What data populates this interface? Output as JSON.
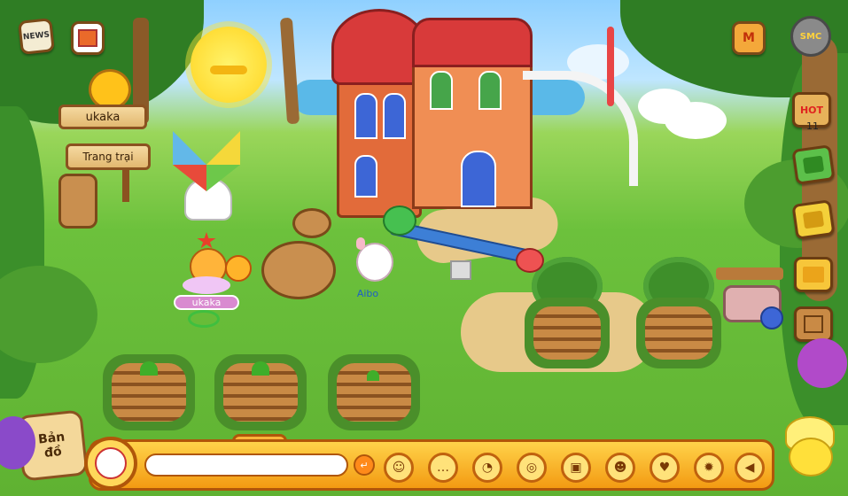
{
  "hud": {
    "news_label": "NEWS",
    "player_name_sign": "ukaka",
    "farm_sign": "Trang trại",
    "hot_label": "HOT",
    "hot_count": "11",
    "map_label_line1": "Bản",
    "map_label_line2": "đồ",
    "smc_label": "SMC"
  },
  "characters": {
    "player_name": "ukaka",
    "pet_name": "Aibo"
  },
  "chat": {
    "input_value": "",
    "send_icon": "enter-arrow-icon"
  },
  "emotes": [
    "smile-emote-icon",
    "speech-bubble-icon",
    "ring-emote-icon",
    "target-icon",
    "chest-icon",
    "action-face-icon",
    "heart-face-icon",
    "angry-face-icon",
    "speaker-icon"
  ],
  "colors": {
    "bar_orange": "#f39a12",
    "bar_border": "#b0560a",
    "grass": "#6cc13c",
    "soil": "#c98a45"
  }
}
